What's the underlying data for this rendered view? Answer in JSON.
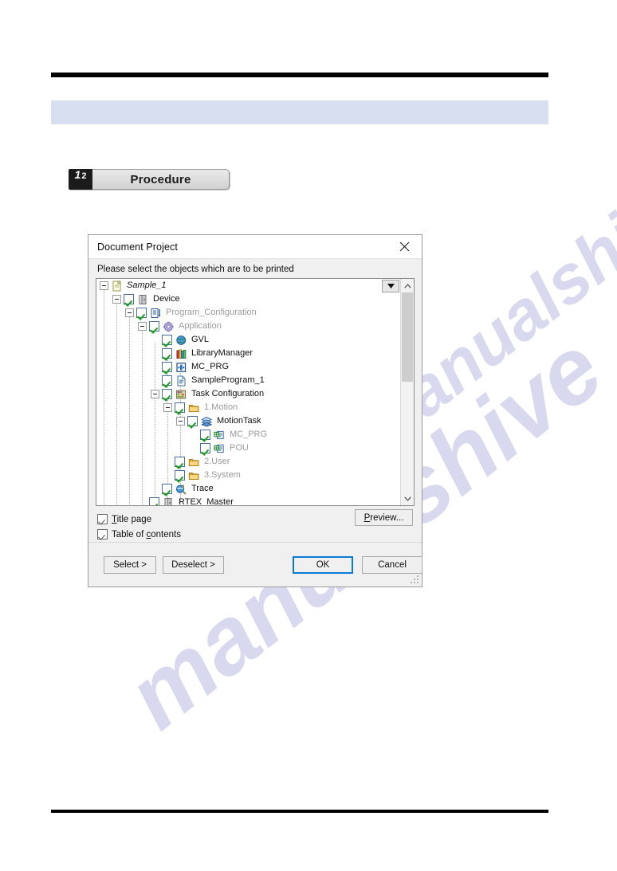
{
  "page": {
    "procedure_number_1": "1",
    "procedure_number_2": "2",
    "procedure_label": "Procedure",
    "watermark_a": "manualshive.com",
    "watermark_b": "manualshive"
  },
  "dialog": {
    "title": "Document Project",
    "close_icon": "close-icon",
    "prompt": "Please select the objects which are to be printed",
    "tree": {
      "items": [
        {
          "label": "Sample_1",
          "depth": 0,
          "twisty": "minus",
          "checkbox": false,
          "icon": "project-icon",
          "style": "italic"
        },
        {
          "label": "Device",
          "depth": 1,
          "twisty": "minus",
          "checkbox": true,
          "icon": "device-icon",
          "style": "normal"
        },
        {
          "label": "Program_Configuration",
          "depth": 2,
          "twisty": "minus",
          "checkbox": true,
          "icon": "plc-icon",
          "style": "grey"
        },
        {
          "label": "Application",
          "depth": 3,
          "twisty": "minus",
          "checkbox": true,
          "icon": "application-icon",
          "style": "grey"
        },
        {
          "label": "GVL",
          "depth": 4,
          "twisty": "none",
          "checkbox": true,
          "icon": "gvl-icon",
          "style": "normal"
        },
        {
          "label": "LibraryManager",
          "depth": 4,
          "twisty": "none",
          "checkbox": true,
          "icon": "library-icon",
          "style": "normal"
        },
        {
          "label": "MC_PRG",
          "depth": 4,
          "twisty": "none",
          "checkbox": true,
          "icon": "program-icon",
          "style": "normal"
        },
        {
          "label": "SampleProgram_1",
          "depth": 4,
          "twisty": "none",
          "checkbox": true,
          "icon": "document-icon",
          "style": "normal"
        },
        {
          "label": "Task Configuration",
          "depth": 4,
          "twisty": "minus",
          "checkbox": true,
          "icon": "task-config-icon",
          "style": "normal"
        },
        {
          "label": "1.Motion",
          "depth": 5,
          "twisty": "minus",
          "checkbox": true,
          "icon": "folder-icon",
          "style": "grey"
        },
        {
          "label": "MotionTask",
          "depth": 6,
          "twisty": "minus",
          "checkbox": true,
          "icon": "task-icon",
          "style": "normal"
        },
        {
          "label": "MC_PRG",
          "depth": 7,
          "twisty": "none",
          "checkbox": true,
          "icon": "pou-ref-icon",
          "style": "grey"
        },
        {
          "label": "POU",
          "depth": 7,
          "twisty": "none",
          "checkbox": true,
          "icon": "pou-ref-icon",
          "style": "grey"
        },
        {
          "label": "2.User",
          "depth": 5,
          "twisty": "none",
          "checkbox": true,
          "icon": "folder-icon",
          "style": "grey"
        },
        {
          "label": "3.System",
          "depth": 5,
          "twisty": "none",
          "checkbox": true,
          "icon": "folder-icon",
          "style": "grey"
        },
        {
          "label": "Trace",
          "depth": 4,
          "twisty": "none",
          "checkbox": true,
          "icon": "trace-icon",
          "style": "normal"
        },
        {
          "label": "RTEX_Master",
          "depth": 3,
          "twisty": "none",
          "checkbox": true,
          "icon": "device-icon",
          "style": "normal"
        }
      ],
      "dropdown_icon": "chevron-down-icon",
      "scroll_up_icon": "chevron-up-icon",
      "scroll_down_icon": "chevron-down-icon"
    },
    "options": {
      "title_page": {
        "label_pre": "",
        "accel": "T",
        "label_post": "itle page",
        "checked": true
      },
      "table_of_contents": {
        "label_pre": "Table of ",
        "accel": "c",
        "label_post": "ontents",
        "checked": true
      },
      "preview_accel": "P",
      "preview_post": "review..."
    },
    "footer": {
      "select": "Select >",
      "deselect": "Deselect >",
      "ok": "OK",
      "cancel": "Cancel"
    }
  },
  "colors": {
    "band": "#d7dff0",
    "rule": "#000000",
    "focus_blue": "#0a7ad6",
    "check_green": "#16a016",
    "watermark": "#b9b9e2"
  }
}
